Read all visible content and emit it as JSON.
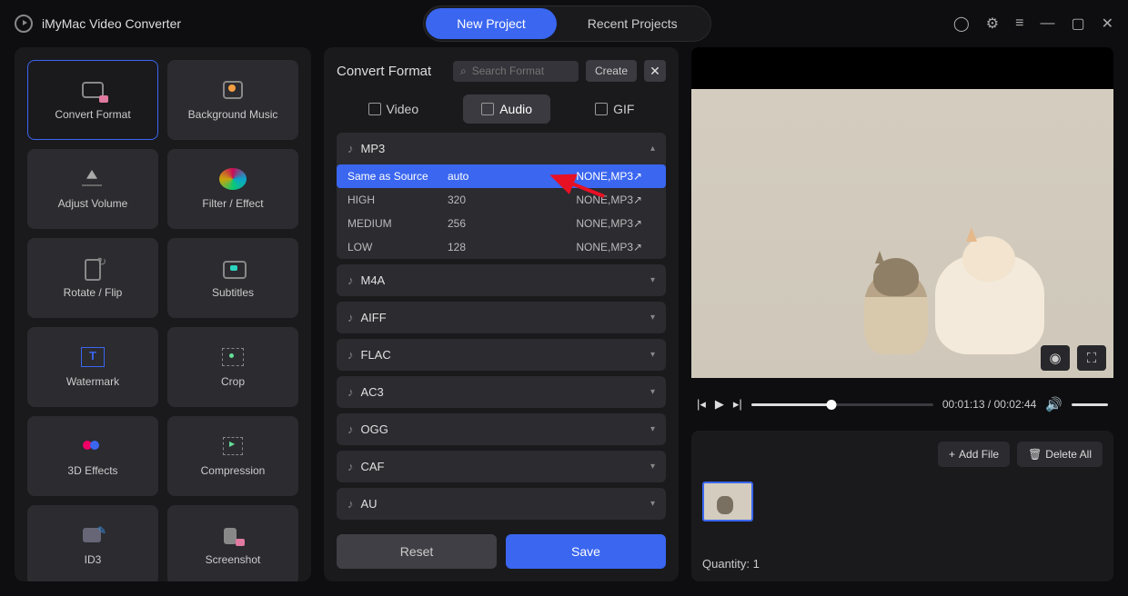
{
  "app_title": "iMyMac Video Converter",
  "header": {
    "new_project": "New Project",
    "recent_projects": "Recent Projects"
  },
  "tools": [
    {
      "label": "Convert Format",
      "icon": "ic-convert",
      "active": true
    },
    {
      "label": "Background Music",
      "icon": "ic-bgm"
    },
    {
      "label": "Adjust Volume",
      "icon": "ic-volume"
    },
    {
      "label": "Filter / Effect",
      "icon": "ic-filter"
    },
    {
      "label": "Rotate / Flip",
      "icon": "ic-rotate"
    },
    {
      "label": "Subtitles",
      "icon": "ic-subs"
    },
    {
      "label": "Watermark",
      "icon": "ic-wm"
    },
    {
      "label": "Crop",
      "icon": "ic-crop"
    },
    {
      "label": "3D Effects",
      "icon": "ic-3d"
    },
    {
      "label": "Compression",
      "icon": "ic-comp"
    },
    {
      "label": "ID3",
      "icon": "ic-id3"
    },
    {
      "label": "Screenshot",
      "icon": "ic-shot"
    }
  ],
  "convert": {
    "title": "Convert Format",
    "search_placeholder": "Search Format",
    "create": "Create",
    "tabs": {
      "video": "Video",
      "audio": "Audio",
      "gif": "GIF"
    },
    "groups": [
      {
        "name": "MP3",
        "expanded": true,
        "rows": [
          {
            "profile": "Same as Source",
            "bitrate": "auto",
            "codec": "NONE,MP3",
            "selected": true
          },
          {
            "profile": "HIGH",
            "bitrate": "320",
            "codec": "NONE,MP3"
          },
          {
            "profile": "MEDIUM",
            "bitrate": "256",
            "codec": "NONE,MP3"
          },
          {
            "profile": "LOW",
            "bitrate": "128",
            "codec": "NONE,MP3"
          }
        ]
      },
      {
        "name": "M4A"
      },
      {
        "name": "AIFF"
      },
      {
        "name": "FLAC"
      },
      {
        "name": "AC3"
      },
      {
        "name": "OGG"
      },
      {
        "name": "CAF"
      },
      {
        "name": "AU"
      }
    ],
    "reset": "Reset",
    "save": "Save"
  },
  "player": {
    "current": "00:01:13",
    "duration": "00:02:44",
    "separator": " / "
  },
  "queue": {
    "add_file": "Add File",
    "delete_all": "Delete All",
    "quantity_label": "Quantity: ",
    "quantity": "1"
  }
}
